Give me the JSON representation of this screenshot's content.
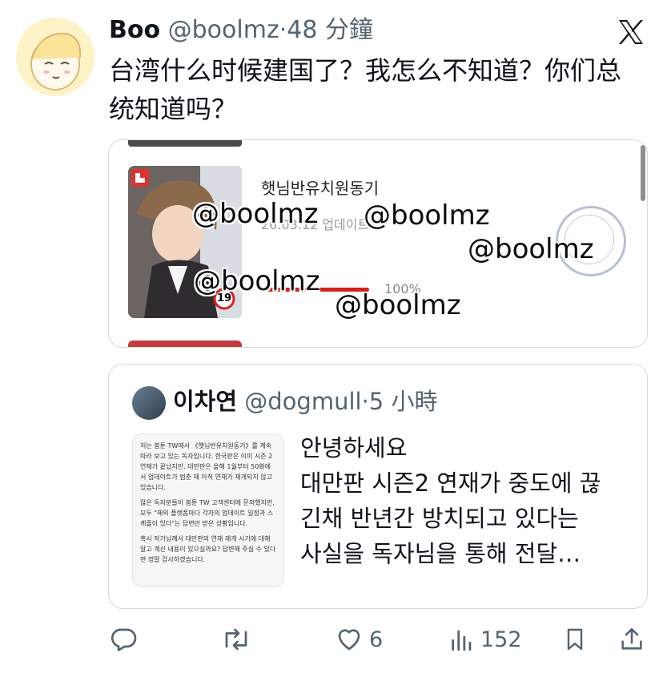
{
  "tweet": {
    "author_name": "Boo",
    "author_handle": "@boolmz",
    "time_sep": "·",
    "time": "48 分鐘",
    "text": "台湾什么时候建国了？我怎么不知道？你们总统知道吗？"
  },
  "media": {
    "work_title": "햇님반유치원동기",
    "work_date": "26.03.12 업데이트",
    "progress": "100%",
    "age_badge": "19",
    "watermark": "@boolmz"
  },
  "quoted": {
    "author_name": "이차연",
    "author_handle": "@dogmull",
    "time_sep": "·",
    "time": "5 小時",
    "text_lines": [
      "안녕하세요",
      "대만판 시즌2 연재가 중도에 끊",
      "긴채 반년간 방치되고 있다는",
      "사실을 독자님을 통해 전달…"
    ],
    "image_paragraphs": [
      "저는 봄툰 TW에서 《햇님반유치원동기》를 계속 따라 보고 있는 독자입니다. 한국판은 이미 시즌 2 연재가 끝났지만, 대만판은 올해 1월부터 50화에서 업데이트가 멈춘 채 아직 연재가 재개되지 않고 있습니다.",
      "많은 독자분들이 봄툰 TW 고객센터에 문의했지만, 모두 \"해외 플랫폼마다 각자의 업데이트 일정과 스케줄이 있다\"는 답변만 받은 상황입니다.",
      "혹시 작가님께서 대만판의 연재 재개 시기에 대해 알고 계신 내용이 있으실까요? 답변해 주실 수 있다면 정말 감사하겠습니다."
    ]
  },
  "actions": {
    "replies": "",
    "reposts": "",
    "likes": "6",
    "views": "152"
  },
  "icons": [
    "x-logo-icon",
    "reply-icon",
    "repost-icon",
    "like-icon",
    "views-icon",
    "bookmark-icon",
    "share-icon"
  ],
  "colors": {
    "text": "#0f1419",
    "secondary": "#536471",
    "border": "#cfd9de",
    "accent_red": "#d32020"
  }
}
